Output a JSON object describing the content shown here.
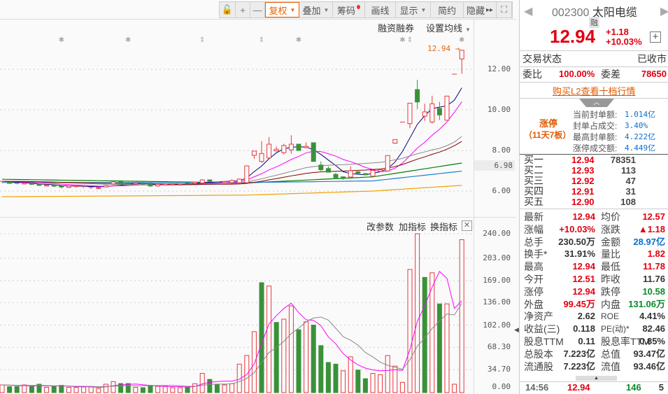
{
  "toolbar": {
    "buttons": [
      {
        "label": "",
        "icon": "lock-icon"
      },
      {
        "label": "+",
        "icon": "zoom-in-icon"
      },
      {
        "label": "—",
        "icon": "zoom-out-icon"
      },
      {
        "label": "复权",
        "dropdown": true,
        "active": true
      },
      {
        "label": "叠加",
        "dropdown": true
      },
      {
        "label": "筹码",
        "badge_dot": true
      },
      {
        "label": "画线"
      },
      {
        "label": "显示",
        "dropdown": true
      },
      {
        "label": "简约"
      },
      {
        "label": "隐藏",
        "arrows": "▸▸"
      },
      {
        "label": "",
        "icon": "fullscreen-icon"
      }
    ]
  },
  "chart_header": {
    "margin_label": "融资融券",
    "ma_settings_label": "设置均线"
  },
  "volume_header": {
    "edit_params": "改参数",
    "add_indicator": "加指标",
    "switch_indicator": "换指标"
  },
  "colors": {
    "up": "#e8383d",
    "down": "#3a913a",
    "accent": "#e8650a"
  },
  "chart_data": [
    {
      "type": "candlestick",
      "title": "日K",
      "price_axis": [
        "12.00",
        "10.00",
        "8.00",
        "6.00"
      ],
      "price_ticks": [
        12,
        10,
        8,
        6
      ],
      "highlight_label": "6.98",
      "last_price_label": "12.94",
      "ohlc": [
        [
          6.45,
          6.5,
          6.4,
          6.48
        ],
        [
          6.45,
          6.47,
          6.36,
          6.38
        ],
        [
          6.38,
          6.4,
          6.33,
          6.35
        ],
        [
          6.35,
          6.42,
          6.33,
          6.4
        ],
        [
          6.4,
          6.42,
          6.3,
          6.33
        ],
        [
          6.35,
          6.37,
          6.25,
          6.28
        ],
        [
          6.25,
          6.32,
          6.22,
          6.3
        ],
        [
          6.3,
          6.33,
          6.2,
          6.24
        ],
        [
          6.25,
          6.27,
          6.13,
          6.2
        ],
        [
          6.18,
          6.27,
          6.15,
          6.25
        ],
        [
          6.22,
          6.28,
          6.18,
          6.26
        ],
        [
          6.2,
          6.25,
          6.15,
          6.22
        ],
        [
          6.15,
          6.2,
          6.1,
          6.18
        ],
        [
          6.13,
          6.2,
          6.1,
          6.17
        ],
        [
          6.2,
          6.3,
          6.18,
          6.27
        ],
        [
          6.35,
          6.5,
          6.3,
          6.45
        ],
        [
          6.45,
          6.48,
          6.33,
          6.36
        ],
        [
          6.4,
          6.45,
          6.33,
          6.35
        ],
        [
          6.35,
          6.42,
          6.3,
          6.4
        ],
        [
          6.4,
          6.43,
          6.3,
          6.35
        ],
        [
          6.38,
          6.4,
          6.2,
          6.25
        ],
        [
          6.25,
          6.35,
          6.22,
          6.33
        ],
        [
          6.3,
          6.38,
          6.28,
          6.35
        ],
        [
          6.32,
          6.38,
          6.3,
          6.36
        ],
        [
          6.3,
          6.36,
          6.28,
          6.34
        ],
        [
          6.38,
          6.4,
          6.33,
          6.35
        ],
        [
          6.38,
          6.46,
          6.36,
          6.44
        ],
        [
          6.4,
          6.58,
          6.38,
          6.55
        ],
        [
          6.55,
          6.57,
          6.45,
          6.48
        ],
        [
          6.45,
          6.48,
          6.4,
          6.42
        ],
        [
          6.42,
          6.5,
          6.4,
          6.47
        ],
        [
          6.42,
          6.58,
          6.4,
          6.52
        ],
        [
          6.41,
          6.62,
          6.38,
          6.59
        ],
        [
          6.41,
          7.26,
          6.4,
          7.24
        ],
        [
          7.76,
          7.97,
          7.59,
          7.97
        ],
        [
          7.46,
          8.46,
          7.39,
          7.85
        ],
        [
          7.63,
          8.66,
          7.6,
          8.31
        ],
        [
          7.98,
          8.2,
          7.95,
          8.06
        ],
        [
          7.89,
          8.33,
          7.8,
          8.24
        ],
        [
          8.03,
          8.75,
          7.84,
          8.31
        ],
        [
          8.31,
          8.31,
          8.0,
          8.0
        ],
        [
          8.14,
          8.4,
          8.1,
          8.2
        ],
        [
          8.38,
          8.38,
          7.46,
          7.46
        ],
        [
          7.28,
          7.46,
          6.98,
          7.05
        ],
        [
          7.11,
          7.22,
          6.93,
          6.93
        ],
        [
          6.82,
          6.9,
          6.66,
          6.66
        ],
        [
          6.7,
          6.72,
          6.55,
          6.66
        ],
        [
          6.69,
          7.22,
          6.69,
          7.0
        ],
        [
          6.95,
          6.99,
          6.84,
          6.88
        ],
        [
          6.86,
          6.88,
          6.78,
          6.8
        ],
        [
          6.73,
          7.05,
          6.73,
          7.02
        ],
        [
          6.97,
          7.1,
          6.95,
          7.05
        ],
        [
          6.99,
          7.75,
          6.99,
          7.75
        ],
        [
          8.36,
          8.54,
          8.33,
          8.54
        ],
        [
          9.4,
          9.4,
          9.4,
          9.4
        ],
        [
          9.32,
          10.33,
          9.1,
          10.33
        ],
        [
          11.0,
          11.48,
          10.04,
          10.39
        ],
        [
          9.69,
          10.3,
          9.46,
          9.9
        ],
        [
          9.4,
          10.7,
          9.32,
          10.3
        ],
        [
          10.07,
          10.4,
          9.5,
          9.75
        ],
        [
          9.49,
          10.68,
          9.49,
          10.68
        ],
        [
          11.76,
          11.76,
          11.76,
          11.76
        ],
        [
          12.51,
          12.94,
          11.78,
          12.94
        ]
      ],
      "ma_periods": [
        {
          "name": "MA5",
          "period": 5,
          "color": "#000080"
        },
        {
          "name": "MA10",
          "period": 10,
          "color": "#ff00ff"
        },
        {
          "name": "MA20",
          "period": 20,
          "color": "#888888"
        },
        {
          "name": "MA30",
          "period": 30,
          "color": "#800000"
        }
      ],
      "ma_long": [
        {
          "name": "MA60",
          "color": "#008000",
          "points": [
            [
              0,
              6.58
            ],
            [
              15,
              6.5
            ],
            [
              33,
              6.4
            ],
            [
              50,
              6.7
            ],
            [
              62,
              7.38
            ]
          ]
        },
        {
          "name": "MA120",
          "color": "#1e7fd0",
          "points": [
            [
              0,
              6.42
            ],
            [
              33,
              6.42
            ],
            [
              50,
              6.5
            ],
            [
              62,
              6.98
            ]
          ]
        },
        {
          "name": "MA250",
          "color": "#f0a000",
          "points": [
            [
              0,
              5.72
            ],
            [
              33,
              5.8
            ],
            [
              50,
              6.0
            ],
            [
              62,
              6.28
            ]
          ]
        }
      ],
      "markers": [
        {
          "i": 8,
          "type": "star"
        },
        {
          "i": 17,
          "type": "star"
        },
        {
          "i": 27,
          "type": "arrow"
        },
        {
          "i": 35,
          "type": "arrow"
        },
        {
          "i": 40,
          "type": "star"
        },
        {
          "i": 54,
          "type": "star"
        },
        {
          "i": 55,
          "type": "arrow"
        },
        {
          "i": 62,
          "type": "star"
        }
      ]
    },
    {
      "type": "bar",
      "title": "成交量",
      "yaxis": [
        "240.00",
        "203.00",
        "169.00",
        "136.00",
        "102.00",
        "68.30",
        "34.70",
        "0.00"
      ],
      "yticks": [
        240,
        203,
        169,
        136,
        102,
        68.3,
        34.7,
        0
      ],
      "values": [
        11.6,
        9,
        9,
        11.6,
        9,
        12.7,
        8,
        9,
        11,
        8,
        8,
        8.5,
        8.5,
        6,
        12.7,
        16.6,
        13.7,
        13.7,
        8,
        7.4,
        11,
        9.5,
        9.5,
        7.4,
        7.4,
        8,
        13.4,
        29,
        20,
        12.7,
        11.6,
        13.4,
        43,
        56,
        92,
        166,
        161,
        106,
        111,
        131,
        95,
        107,
        102,
        71,
        45.5,
        43,
        33,
        54,
        34,
        21,
        29,
        27,
        56,
        40,
        15.5,
        186,
        240,
        174,
        181,
        134,
        134,
        12.7,
        231
      ],
      "up": [
        1,
        0,
        0,
        1,
        0,
        0,
        1,
        0,
        0,
        1,
        1,
        1,
        1,
        1,
        1,
        1,
        0,
        0,
        1,
        0,
        0,
        1,
        1,
        1,
        1,
        0,
        1,
        1,
        0,
        0,
        1,
        1,
        1,
        1,
        1,
        0,
        1,
        0,
        1,
        1,
        0,
        1,
        0,
        0,
        0,
        0,
        1,
        1,
        0,
        0,
        1,
        1,
        1,
        1,
        1,
        1,
        1,
        0,
        1,
        0,
        1,
        1,
        1
      ],
      "ma": [
        {
          "name": "VMA5",
          "period": 5,
          "color": "#ff00ff"
        },
        {
          "name": "VMA10",
          "period": 10,
          "color": "#888888"
        }
      ]
    }
  ],
  "quote": {
    "code": "002300",
    "name": "太阳电缆",
    "margin_badge": "融",
    "price": "12.94",
    "change": "+1.18",
    "change_pct": "+10.03%",
    "trade_status_label": "交易状态",
    "trade_status": "已收市",
    "wb_label": "委比",
    "wb": "100.00%",
    "wc_label": "委差",
    "wc": "78650",
    "l2_link": "购买L2查看十档行情",
    "limit_title": "涨停",
    "limit_sub": "（11天7板）",
    "limit_info": [
      {
        "label": "当前封单额:",
        "value": "1.014亿"
      },
      {
        "label": "封单占成交:",
        "value": "3.40%"
      },
      {
        "label": "最高封单额:",
        "value": "4.222亿"
      },
      {
        "label": "涨停成交额:",
        "value": "4.449亿"
      }
    ],
    "bids": [
      {
        "label": "买一",
        "price": "12.94",
        "vol": "78351"
      },
      {
        "label": "买二",
        "price": "12.93",
        "vol": "113"
      },
      {
        "label": "买三",
        "price": "12.92",
        "vol": "47"
      },
      {
        "label": "买四",
        "price": "12.91",
        "vol": "31"
      },
      {
        "label": "买五",
        "price": "12.90",
        "vol": "108"
      }
    ],
    "stats": [
      [
        {
          "label": "最新",
          "value": "12.94",
          "c": "red"
        },
        {
          "label": "均价",
          "value": "12.57",
          "c": "red"
        }
      ],
      [
        {
          "label": "涨幅",
          "value": "+10.03%",
          "c": "red"
        },
        {
          "label": "涨跌",
          "value": "▲1.18",
          "c": "red"
        }
      ],
      [
        {
          "label": "总手",
          "value": "230.50万",
          "c": ""
        },
        {
          "label": "金额",
          "value": "28.97亿",
          "c": "blu"
        }
      ],
      [
        {
          "label": "换手*",
          "value": "31.91%",
          "c": ""
        },
        {
          "label": "量比",
          "value": "1.82",
          "c": "red"
        }
      ],
      [
        {
          "label": "最高",
          "value": "12.94",
          "c": "red"
        },
        {
          "label": "最低",
          "value": "11.78",
          "c": "red"
        }
      ],
      [
        {
          "label": "今开",
          "value": "12.51",
          "c": "red"
        },
        {
          "label": "昨收",
          "value": "11.76",
          "c": ""
        }
      ],
      [
        {
          "label": "涨停",
          "value": "12.94",
          "c": "red"
        },
        {
          "label": "跌停",
          "value": "10.58",
          "c": "grn"
        }
      ],
      [
        {
          "label": "外盘",
          "value": "99.45万",
          "c": "red"
        },
        {
          "label": "内盘",
          "value": "131.06万",
          "c": "grn"
        }
      ],
      [
        {
          "label": "净资产",
          "value": "2.62",
          "c": ""
        },
        {
          "label": "ROE",
          "value": "4.41%",
          "c": ""
        }
      ],
      [
        {
          "label": "收益(三)",
          "value": "0.118",
          "c": ""
        },
        {
          "label": "PE(动)*",
          "value": "82.46",
          "c": ""
        }
      ],
      [
        {
          "label": "股息TTM",
          "value": "0.11",
          "c": ""
        },
        {
          "label": "股息率TTM",
          "value": "0.85%",
          "c": ""
        }
      ],
      [
        {
          "label": "总股本",
          "value": "7.223亿",
          "c": ""
        },
        {
          "label": "总值",
          "value": "93.47亿",
          "c": ""
        }
      ],
      [
        {
          "label": "流通股",
          "value": "7.223亿",
          "c": ""
        },
        {
          "label": "流值",
          "value": "93.46亿",
          "c": ""
        }
      ]
    ],
    "last_tick": {
      "time": "14:56",
      "price": "12.94",
      "vol": "146",
      "count": "5"
    }
  }
}
